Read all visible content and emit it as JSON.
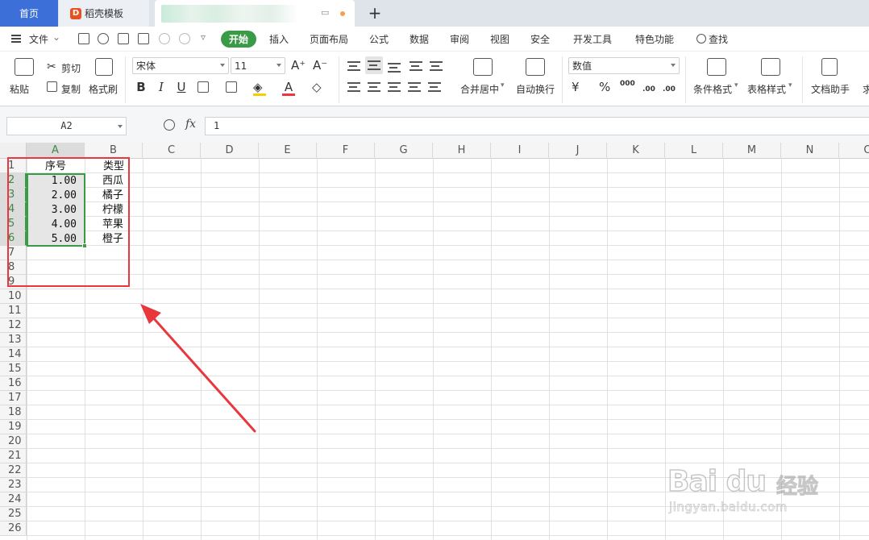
{
  "tabs": {
    "home": "首页",
    "templates": "稻壳模板",
    "new_tab": "+"
  },
  "menu": {
    "file": "文件",
    "start": "开始",
    "insert": "插入",
    "page_layout": "页面布局",
    "formula": "公式",
    "data": "数据",
    "review": "审阅",
    "view": "视图",
    "security": "安全",
    "developer": "开发工具",
    "features": "特色功能",
    "search": "查找"
  },
  "ribbon": {
    "paste": "粘贴",
    "cut": "剪切",
    "copy": "复制",
    "format_painter": "格式刷",
    "font_name": "宋体",
    "font_size": "11",
    "grow_font": "A⁺",
    "shrink_font": "A⁻",
    "bold": "B",
    "italic": "I",
    "underline": "U",
    "font_color": "A",
    "merge_center": "合并居中",
    "wrap_text": "自动换行",
    "number_format": "数值",
    "percent": "%",
    "thousands": "000",
    "dec_inc": ".00",
    "dec_dec": ".00",
    "conditional_format": "条件格式",
    "table_style": "表格样式",
    "doc_assistant": "文档助手",
    "cut_off": "求"
  },
  "formula_bar": {
    "name_box": "A2",
    "fx": "fx",
    "value": "1"
  },
  "sheet": {
    "columns": [
      "A",
      "B",
      "C",
      "D",
      "E",
      "F",
      "G",
      "H",
      "I",
      "J",
      "K",
      "L",
      "M",
      "N",
      "O"
    ],
    "rows": [
      "1",
      "2",
      "3",
      "4",
      "5",
      "6",
      "7",
      "8",
      "9",
      "10",
      "11",
      "12",
      "13",
      "14",
      "15",
      "16",
      "17",
      "18",
      "19",
      "20",
      "21",
      "22",
      "23",
      "24",
      "25",
      "26"
    ],
    "header_a": "序号",
    "header_b": "类型",
    "numbers": [
      "1.00",
      "2.00",
      "3.00",
      "4.00",
      "5.00"
    ],
    "types": [
      "西瓜",
      "橘子",
      "柠檬",
      "苹果",
      "橙子"
    ]
  },
  "colors": {
    "accent_green": "#3a9b47",
    "annotation_red": "#e8383d",
    "home_tab_blue": "#3d6fd8"
  },
  "watermark": {
    "brand": "Bai du",
    "brand_cn": "经验",
    "url": "jingyan.baidu.com"
  }
}
